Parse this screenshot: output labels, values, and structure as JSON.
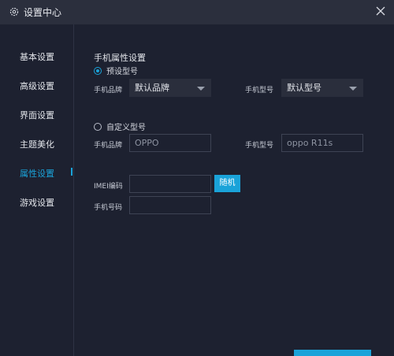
{
  "titlebar": {
    "title": "设置中心"
  },
  "sidebar": {
    "items": [
      {
        "label": "基本设置"
      },
      {
        "label": "高级设置"
      },
      {
        "label": "界面设置"
      },
      {
        "label": "主题美化"
      },
      {
        "label": "属性设置",
        "active": true
      },
      {
        "label": "游戏设置"
      }
    ]
  },
  "content": {
    "section_title": "手机属性设置",
    "preset": {
      "radio_label": "预设型号",
      "brand_label": "手机品牌",
      "brand_value": "默认品牌",
      "model_label": "手机型号",
      "model_value": "默认型号"
    },
    "custom": {
      "radio_label": "自定义型号",
      "brand_label": "手机品牌",
      "brand_value": "OPPO",
      "model_label": "手机型号",
      "model_value": "oppo R11s"
    },
    "imei": {
      "label": "IMEI编码",
      "value": "",
      "random_button": "随机"
    },
    "phone": {
      "label": "手机号码",
      "value": ""
    }
  },
  "colors": {
    "accent": "#1aa3d9",
    "background": "#1d2130",
    "titlebar": "#2b2f3d"
  }
}
